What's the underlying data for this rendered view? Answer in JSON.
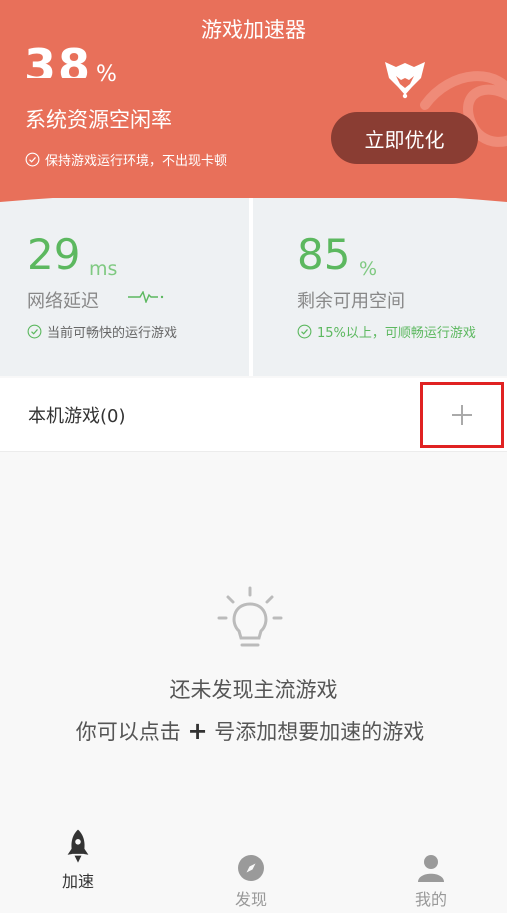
{
  "header": {
    "title": "游戏加速器",
    "resource_value": "38",
    "resource_unit": "%",
    "resource_label": "系统资源空闲率",
    "hint": "保持游戏运行环境，不出现卡顿",
    "optimize_label": "立即优化",
    "colors": {
      "hero": "#e8705a",
      "button": "#8a3d33"
    }
  },
  "stats": [
    {
      "value": "29",
      "unit": "ms",
      "label": "网络延迟",
      "note": "当前可畅快的运行游戏",
      "icon": "pulse-icon"
    },
    {
      "value": "85",
      "unit": "%",
      "label": "剩余可用空间",
      "note": "15%以上，可顺畅运行游戏"
    }
  ],
  "local_games": {
    "label": "本机游戏(0)",
    "add_symbol": "+"
  },
  "empty_state": {
    "title": "还未发现主流游戏",
    "sub_prefix": "你可以点击",
    "sub_plus": "+",
    "sub_suffix": "号添加想要加速的游戏",
    "icon": "lightbulb-icon"
  },
  "tabs": [
    {
      "label": "加速",
      "icon": "rocket-icon",
      "active": true
    },
    {
      "label": "发现",
      "icon": "compass-icon",
      "active": false
    },
    {
      "label": "我的",
      "icon": "user-icon",
      "active": false
    }
  ]
}
